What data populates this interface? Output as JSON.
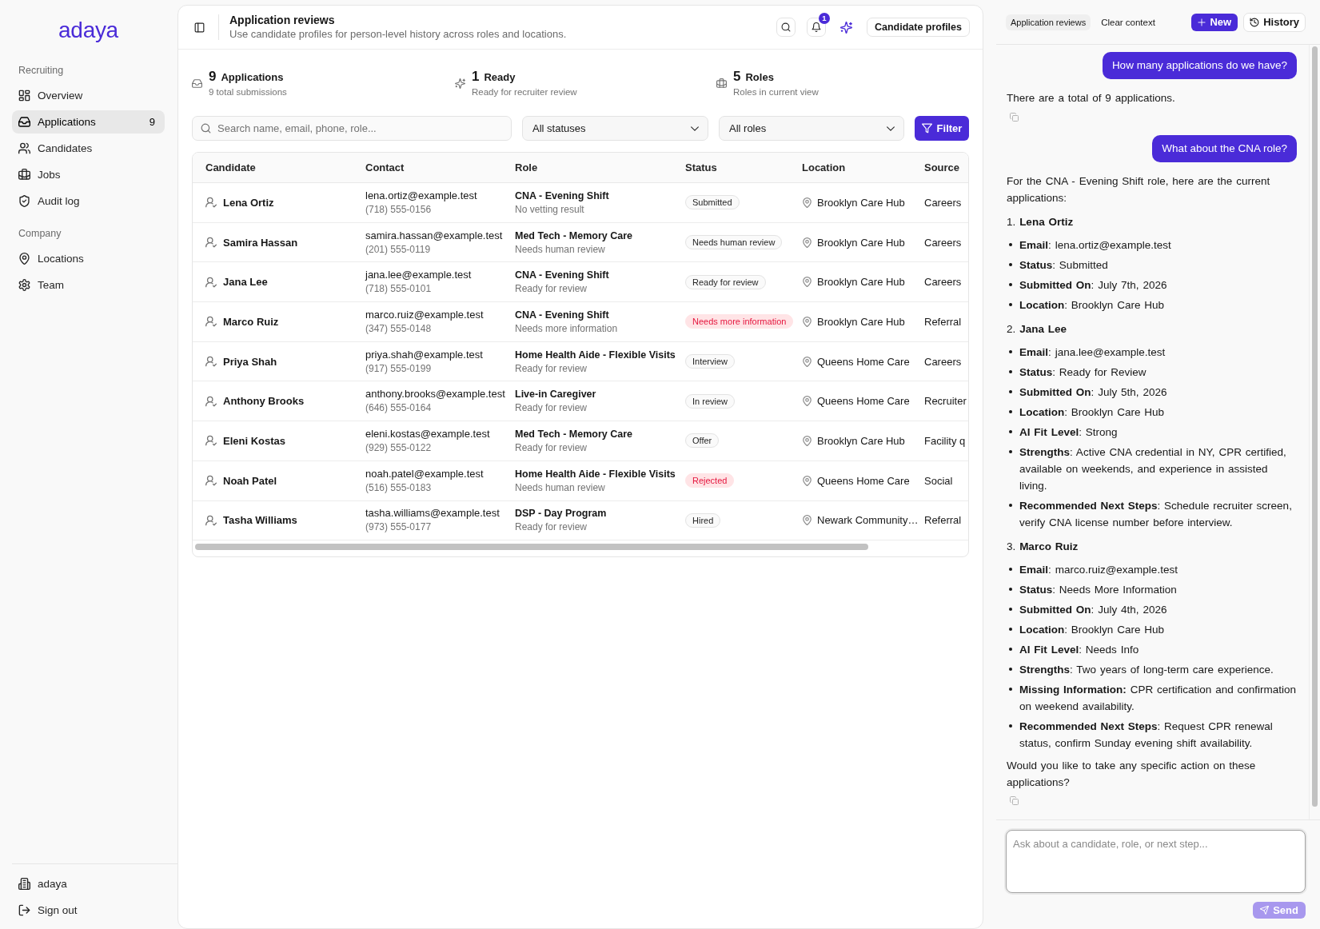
{
  "sidebar": {
    "logo": "adaya",
    "sections": [
      {
        "heading": "Recruiting",
        "items": [
          {
            "label": "Overview",
            "selected": false
          },
          {
            "label": "Applications",
            "count": "9",
            "selected": true
          },
          {
            "label": "Candidates",
            "selected": false
          },
          {
            "label": "Jobs",
            "selected": false
          },
          {
            "label": "Audit log",
            "selected": false
          }
        ]
      },
      {
        "heading": "Company",
        "items": [
          {
            "label": "Locations",
            "selected": false
          },
          {
            "label": "Team",
            "selected": false
          }
        ]
      }
    ],
    "footer": [
      {
        "label": "adaya"
      },
      {
        "label": "Sign out"
      }
    ]
  },
  "header": {
    "title": "Application reviews",
    "subtitle": "Use candidate profiles for person-level history across roles and locations.",
    "notification_count": "1",
    "profiles_button": "Candidate profiles"
  },
  "stats": [
    {
      "value": "9",
      "label": "Applications",
      "caption": "9 total submissions"
    },
    {
      "value": "1",
      "label": "Ready",
      "caption": "Ready for recruiter review"
    },
    {
      "value": "5",
      "label": "Roles",
      "caption": "Roles in current view"
    }
  ],
  "filters": {
    "search": {
      "placeholder": "Search name, email, phone, role..."
    },
    "status_select": {
      "value": "All statuses"
    },
    "role_select": {
      "value": "All roles"
    },
    "filter_button": "Filter"
  },
  "table": {
    "columns": [
      "Candidate",
      "Contact",
      "Role",
      "Status",
      "Location",
      "Source"
    ],
    "rows": [
      {
        "candidate": "Lena Ortiz",
        "email": "lena.ortiz@example.test",
        "phone": "(718) 555-0156",
        "role": "CNA - Evening Shift",
        "role_note": "No vetting result",
        "status": {
          "label": "Submitted",
          "kind": "neutral"
        },
        "location": "Brooklyn Care Hub",
        "source": "Careers"
      },
      {
        "candidate": "Samira Hassan",
        "email": "samira.hassan@example.test",
        "phone": "(201) 555-0119",
        "role": "Med Tech - Memory Care",
        "role_note": "Needs human review",
        "status": {
          "label": "Needs human review",
          "kind": "neutral"
        },
        "location": "Brooklyn Care Hub",
        "source": "Careers"
      },
      {
        "candidate": "Jana Lee",
        "email": "jana.lee@example.test",
        "phone": "(718) 555-0101",
        "role": "CNA - Evening Shift",
        "role_note": "Ready for review",
        "status": {
          "label": "Ready for review",
          "kind": "neutral"
        },
        "location": "Brooklyn Care Hub",
        "source": "Careers"
      },
      {
        "candidate": "Marco Ruiz",
        "email": "marco.ruiz@example.test",
        "phone": "(347) 555-0148",
        "role": "CNA - Evening Shift",
        "role_note": "Needs more information",
        "status": {
          "label": "Needs more information",
          "kind": "danger"
        },
        "location": "Brooklyn Care Hub",
        "source": "Referral"
      },
      {
        "candidate": "Priya Shah",
        "email": "priya.shah@example.test",
        "phone": "(917) 555-0199",
        "role": "Home Health Aide - Flexible Visits",
        "role_note": "Ready for review",
        "status": {
          "label": "Interview",
          "kind": "neutral"
        },
        "location": "Queens Home Care",
        "source": "Careers"
      },
      {
        "candidate": "Anthony Brooks",
        "email": "anthony.brooks@example.test",
        "phone": "(646) 555-0164",
        "role": "Live-in Caregiver",
        "role_note": "Ready for review",
        "status": {
          "label": "In review",
          "kind": "neutral"
        },
        "location": "Queens Home Care",
        "source": "Recruiter"
      },
      {
        "candidate": "Eleni Kostas",
        "email": "eleni.kostas@example.test",
        "phone": "(929) 555-0122",
        "role": "Med Tech - Memory Care",
        "role_note": "Ready for review",
        "status": {
          "label": "Offer",
          "kind": "neutral"
        },
        "location": "Brooklyn Care Hub",
        "source": "Facility q"
      },
      {
        "candidate": "Noah Patel",
        "email": "noah.patel@example.test",
        "phone": "(516) 555-0183",
        "role": "Home Health Aide - Flexible Visits",
        "role_note": "Needs human review",
        "status": {
          "label": "Rejected",
          "kind": "danger"
        },
        "location": "Queens Home Care",
        "source": "Social"
      },
      {
        "candidate": "Tasha Williams",
        "email": "tasha.williams@example.test",
        "phone": "(973) 555-0177",
        "role": "DSP - Day Program",
        "role_note": "Ready for review",
        "status": {
          "label": "Hired",
          "kind": "neutral"
        },
        "location": "Newark Community…",
        "source": "Referral"
      }
    ]
  },
  "chat": {
    "context_chip": "Application reviews",
    "clear_button": "Clear context",
    "new_button": "New",
    "history_button": "History",
    "messages": [
      {
        "kind": "user",
        "text": "How many applications do we have?"
      },
      {
        "kind": "assistant",
        "blocks": [
          {
            "kind": "paragraph",
            "text": "There are a total of 9 applications."
          }
        ]
      },
      {
        "kind": "user",
        "text": "What about the CNA role?"
      },
      {
        "kind": "assistant",
        "blocks": [
          {
            "kind": "paragraph",
            "text": "For the CNA - Evening Shift role, here are the current applications:"
          },
          {
            "kind": "heading",
            "text": "1. **Lena Ortiz**"
          },
          {
            "kind": "bullet",
            "text": "**Email**: lena.ortiz@example.test"
          },
          {
            "kind": "bullet",
            "text": "**Status**: Submitted"
          },
          {
            "kind": "bullet",
            "text": "**Submitted On**: July 7th, 2026"
          },
          {
            "kind": "bullet",
            "text": "**Location**: Brooklyn Care Hub"
          },
          {
            "kind": "heading",
            "text": "2. **Jana Lee**"
          },
          {
            "kind": "bullet",
            "text": "**Email**: jana.lee@example.test"
          },
          {
            "kind": "bullet",
            "text": "**Status**: Ready for Review"
          },
          {
            "kind": "bullet",
            "text": "**Submitted On**: July 5th, 2026"
          },
          {
            "kind": "bullet",
            "text": "**Location**: Brooklyn Care Hub"
          },
          {
            "kind": "bullet",
            "text": "**AI Fit Level**: Strong"
          },
          {
            "kind": "bullet",
            "text": "**Strengths**: Active CNA credential in NY, CPR certified, available on weekends, and experience in assisted living."
          },
          {
            "kind": "bullet",
            "text": "**Recommended Next Steps**: Schedule recruiter screen, verify CNA license number before interview."
          },
          {
            "kind": "heading",
            "text": "3. **Marco Ruiz**"
          },
          {
            "kind": "bullet",
            "text": "**Email**: marco.ruiz@example.test"
          },
          {
            "kind": "bullet",
            "text": "**Status**: Needs More Information"
          },
          {
            "kind": "bullet",
            "text": "**Submitted On**: July 4th, 2026"
          },
          {
            "kind": "bullet",
            "text": "**Location**: Brooklyn Care Hub"
          },
          {
            "kind": "bullet",
            "text": "**AI Fit Level**: Needs Info"
          },
          {
            "kind": "bullet",
            "text": "**Strengths**: Two years of long-term care experience."
          },
          {
            "kind": "bullet",
            "text": "**Missing Information:** CPR certification and confirmation on weekend availability."
          },
          {
            "kind": "bullet",
            "text": "**Recommended Next Steps**: Request CPR renewal status, confirm Sunday evening shift availability."
          },
          {
            "kind": "paragraph",
            "text": "Would you like to take any specific action on these applications?"
          }
        ]
      }
    ],
    "input": {
      "placeholder": "Ask about a candidate, role, or next step..."
    },
    "send_button": {
      "label": "Send",
      "disabled": true
    }
  }
}
